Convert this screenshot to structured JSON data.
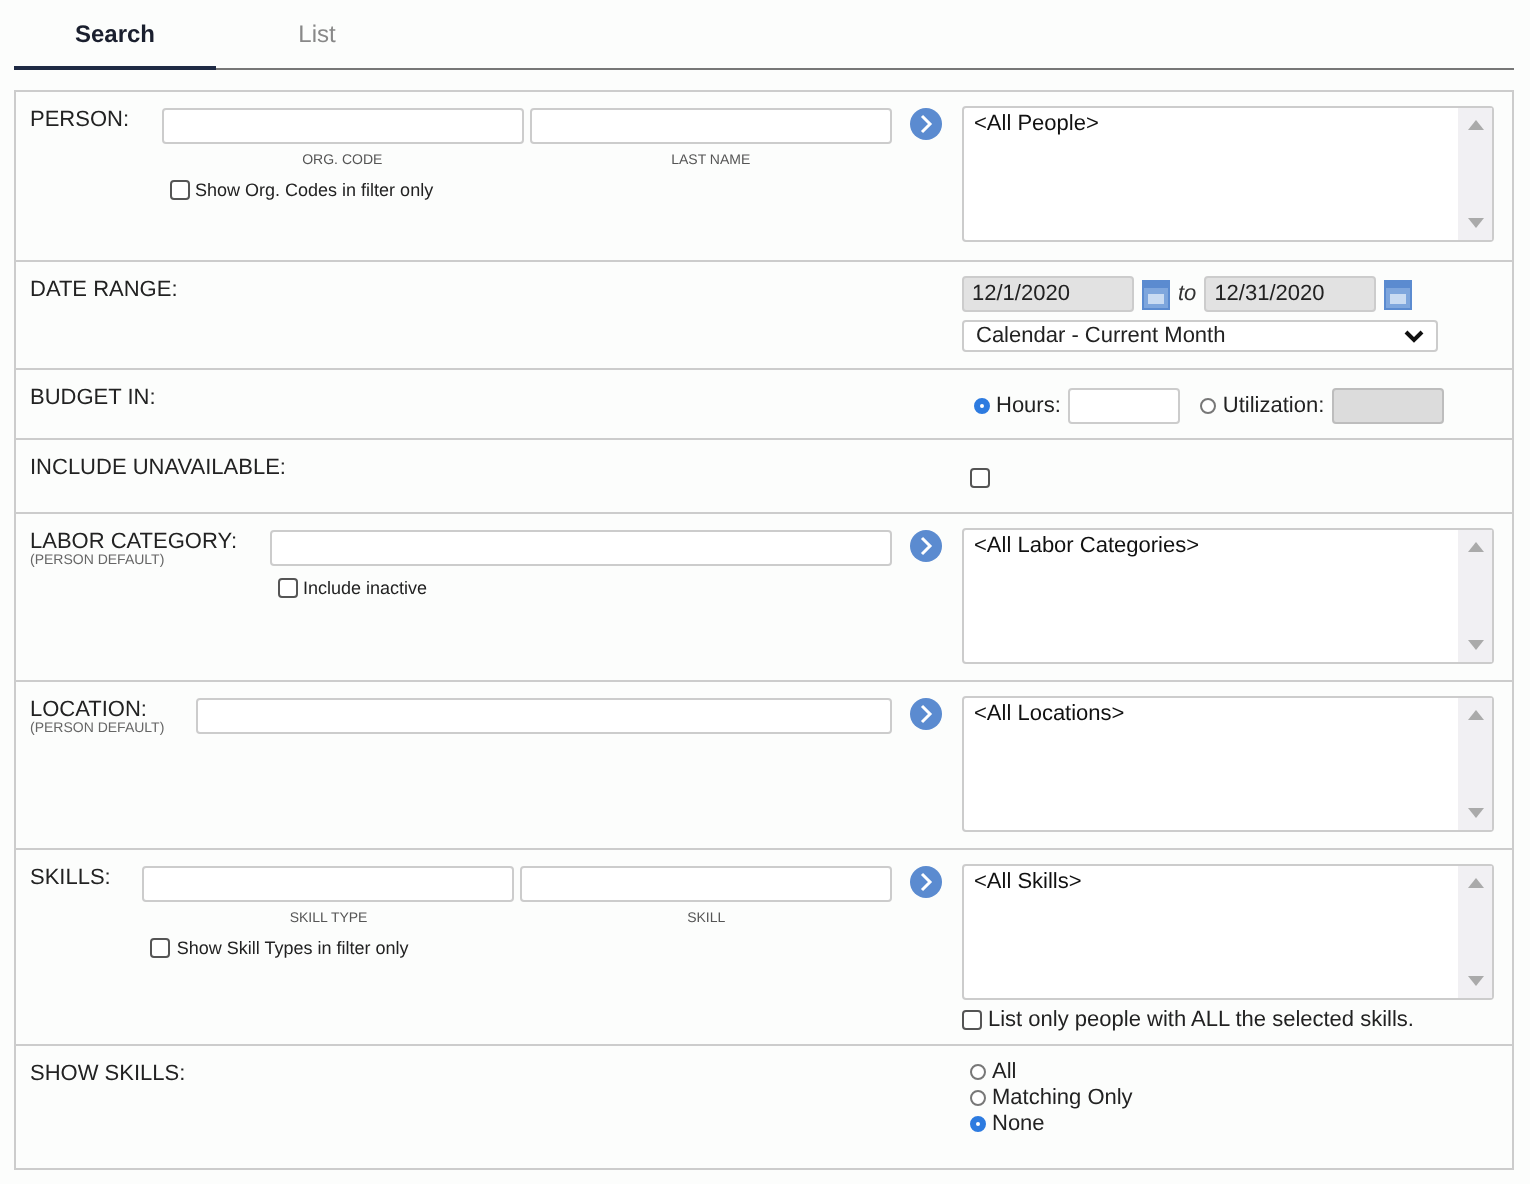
{
  "tabs": [
    {
      "label": "Search",
      "selected": true
    },
    {
      "label": "List",
      "selected": false
    }
  ],
  "rows": [
    {
      "kind": "lookup",
      "label": "PERSON:",
      "captions": [
        "ORG. CODE",
        "LAST NAME"
      ],
      "checkbox": {
        "label": "Show Org. Codes in filter only",
        "checked": false
      },
      "list": [
        "<All People>"
      ]
    },
    {
      "kind": "date",
      "label": "DATE RANGE:",
      "start": "12/1/2020",
      "joiner": "to",
      "end": "12/31/2020",
      "preset": "Calendar - Current Month"
    },
    {
      "kind": "budget",
      "label": "BUDGET IN:",
      "options": [
        {
          "label": "Hours:",
          "selected": true,
          "disabled": false
        },
        {
          "label": "Utilization:",
          "selected": false,
          "disabled": true
        }
      ]
    },
    {
      "kind": "checkbox",
      "label": "INCLUDE UNAVAILABLE:",
      "checked": false
    },
    {
      "kind": "lookup",
      "label": "LABOR CATEGORY:",
      "sublabel": "(PERSON DEFAULT)",
      "checkbox": {
        "label": "Include inactive",
        "checked": false
      },
      "list": [
        "<All Labor Categories>"
      ]
    },
    {
      "kind": "lookup",
      "label": "LOCATION:",
      "sublabel": "(PERSON DEFAULT)",
      "list": [
        "<All Locations>"
      ]
    },
    {
      "kind": "lookup",
      "label": "SKILLS:",
      "captions": [
        "SKILL TYPE",
        "SKILL"
      ],
      "checkbox": {
        "label": "Show Skill Types in filter only",
        "checked": false
      },
      "list": [
        "<All Skills>"
      ],
      "list_checkbox": {
        "label": "List only people with ALL the selected skills.",
        "checked": false
      }
    },
    {
      "kind": "radio",
      "label": "SHOW SKILLS:",
      "options": [
        {
          "label": "All",
          "selected": false
        },
        {
          "label": "Matching Only",
          "selected": false
        },
        {
          "label": "None",
          "selected": true
        }
      ]
    }
  ]
}
